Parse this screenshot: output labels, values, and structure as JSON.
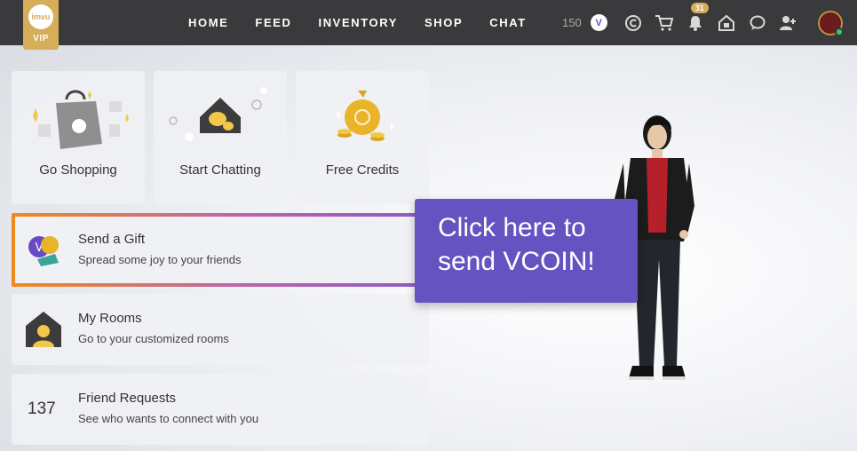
{
  "brand": {
    "logo_text": "imvu",
    "vip_label": "VIP"
  },
  "nav": {
    "links": [
      "HOME",
      "FEED",
      "INVENTORY",
      "SHOP",
      "CHAT"
    ],
    "credits": "150",
    "vcoin_symbol": "V",
    "notification_count": "31",
    "icons": [
      "credits-icon",
      "cart-icon",
      "notifications-icon",
      "rooms-icon",
      "chat-bubble-icon",
      "friends-icon"
    ]
  },
  "tiles": [
    {
      "label": "Go Shopping",
      "icon": "shopping-bag-icon"
    },
    {
      "label": "Start Chatting",
      "icon": "chat-house-icon"
    },
    {
      "label": "Free Credits",
      "icon": "money-bag-icon"
    }
  ],
  "cards": [
    {
      "title": "Send a Gift",
      "subtitle": "Spread some joy to your friends",
      "icon": "gift-vcoin-icon"
    },
    {
      "title": "My Rooms",
      "subtitle": "Go to your customized rooms",
      "icon": "room-house-icon"
    },
    {
      "title": "Friend Requests",
      "subtitle": "See who wants to connect with you",
      "count": "137"
    }
  ],
  "callout": {
    "line1": "Click here to",
    "line2": "send VCOIN!"
  },
  "colors": {
    "topbar": "#3a3a3c",
    "vip_gold": "#d6ad58",
    "callout_purple": "#6453c0",
    "highlight_orange": "#f08a1c",
    "highlight_purple": "#8a5cc8"
  }
}
